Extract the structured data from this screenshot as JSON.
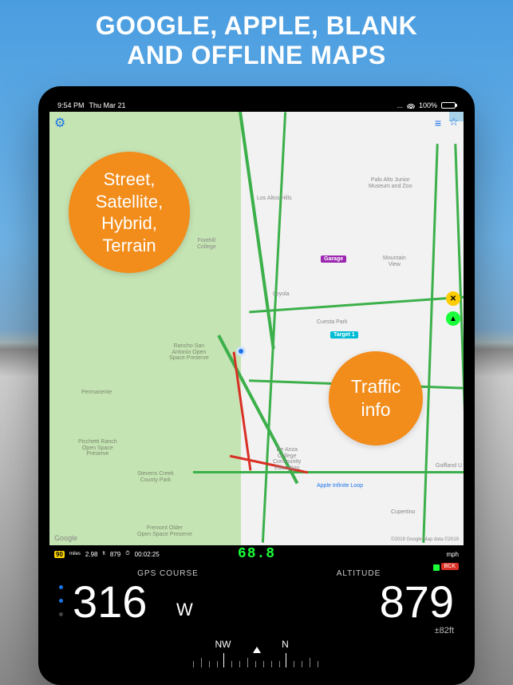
{
  "promo": {
    "headline_line1": "GOOGLE, APPLE, BLANK",
    "headline_line2": "AND OFFLINE MAPS"
  },
  "status": {
    "time": "9:54 PM",
    "date": "Thu Mar 21",
    "connection": "...",
    "battery_pct": "100%"
  },
  "callouts": {
    "map_types": "Street,\nSatellite,\nHybrid,\nTerrain",
    "traffic": "Traffic\ninfo"
  },
  "map": {
    "places": {
      "rancho": "Rancho San\nAntonio Open\nSpace Preserve",
      "permanente": "Permanente",
      "picchetti": "Picchetti Ranch\nOpen Space\nPreserve",
      "stevens": "Stevens Creek\nCounty Park",
      "fremont": "Fremont Older\nOpen Space Preserve",
      "losaltos": "Los Altos Hills",
      "loyola": "Loyola",
      "mtview": "Mountain\nView",
      "cupertino": "Cupertino",
      "cuesta": "Cuesta Park",
      "foothill": "Foothill\nCollege",
      "paloalto_zoo": "Palo Alto Junior\nMuseum and Zoo",
      "deanza": "De Anza\nCollege\nCommunity\nEducation",
      "apple_loop": "Apple Infinite Loop",
      "golfland": "Golfland U"
    },
    "pins": {
      "garage": "Garage",
      "target1": "Target 1"
    },
    "logo": "Google",
    "attribution": "©2019 Google Map data ©2019"
  },
  "dash_thin": {
    "limit_badge": "90",
    "dist_unit": "miles",
    "dist": "2.98",
    "alt_unit": "ft",
    "alt": "879",
    "timer": "00:02:25",
    "speed_digital": "68.8",
    "speed_unit": "mph",
    "bck": "BCK"
  },
  "dash": {
    "course_label": "GPS COURSE",
    "course_value": "316",
    "course_dir": "W",
    "altitude_label": "ALTITUDE",
    "altitude_value": "879",
    "altitude_accuracy": "±82ft",
    "compass_nw": "NW",
    "compass_n": "N"
  }
}
